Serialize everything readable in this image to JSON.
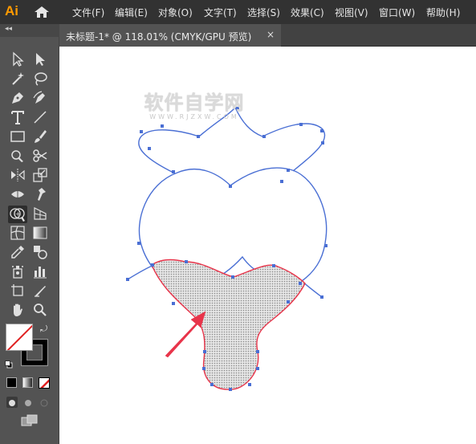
{
  "app": {
    "logo_text": "Ai",
    "home_icon": "home-icon"
  },
  "menu": {
    "items": [
      "文件(F)",
      "编辑(E)",
      "对象(O)",
      "文字(T)",
      "选择(S)",
      "效果(C)",
      "视图(V)",
      "窗口(W)",
      "帮助(H)"
    ]
  },
  "document_tab": {
    "title": "未标题-1* @ 118.01% (CMYK/GPU 预览)",
    "close_label": "×"
  },
  "toolbar": {
    "collapse_label": "◂◂",
    "tools": [
      "selection-tool-icon",
      "direct-selection-tool-icon",
      "magic-wand-tool-icon",
      "lasso-tool-icon",
      "pen-tool-icon",
      "curvature-tool-icon",
      "type-tool-icon",
      "line-segment-tool-icon",
      "rectangle-tool-icon",
      "paintbrush-tool-icon",
      "shaper-tool-icon",
      "scissors-tool-icon",
      "reflect-tool-icon",
      "scale-tool-icon",
      "width-tool-icon",
      "puppet-warp-tool-icon",
      "shape-builder-tool-icon",
      "perspective-grid-tool-icon",
      "mesh-tool-icon",
      "gradient-tool-icon",
      "eyedropper-tool-icon",
      "blend-tool-icon",
      "symbol-sprayer-tool-icon",
      "column-graph-tool-icon",
      "artboard-tool-icon",
      "slice-tool-icon",
      "hand-tool-icon",
      "zoom-tool-icon"
    ],
    "active_tool": "shape-builder-tool-icon",
    "fill_color": "#ffffff",
    "stroke_color": "#000000",
    "none_indicator_color": "#e02020"
  },
  "canvas": {
    "watermark_main": "软件自学网",
    "watermark_sub": "WWW.RJZXW.COM",
    "path_color": "#4a6fd4",
    "selected_path_color": "#e8344a",
    "arrow_color": "#e8344a",
    "fill_pattern_color": "#8a8a8a"
  }
}
